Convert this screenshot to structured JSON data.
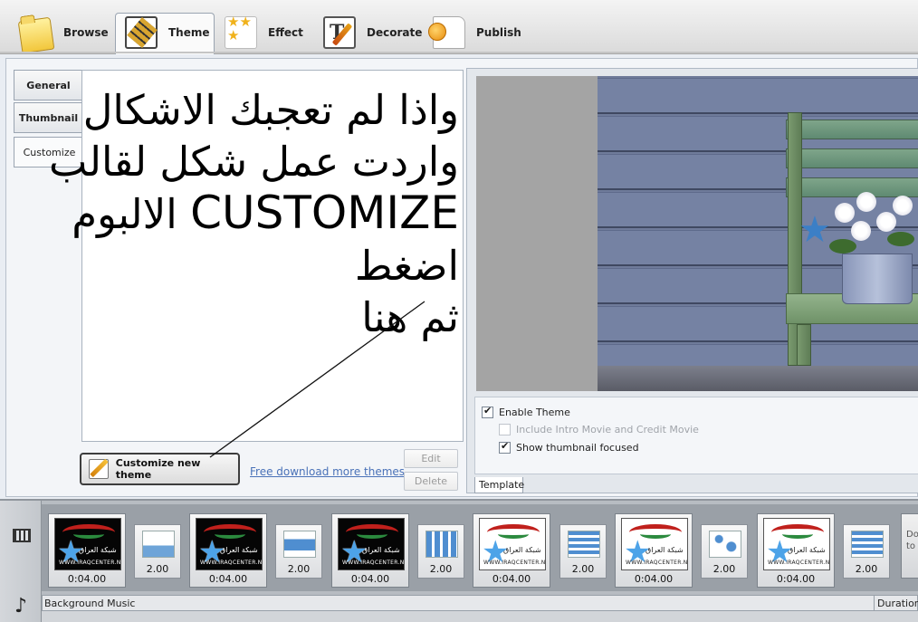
{
  "toolbar": {
    "tabs": [
      {
        "label": "Browse",
        "icon": "folder-icon"
      },
      {
        "label": "Theme",
        "icon": "film-theme-icon",
        "active": true
      },
      {
        "label": "Effect",
        "icon": "stars-icon"
      },
      {
        "label": "Decorate",
        "icon": "decorate-icon"
      },
      {
        "label": "Publish",
        "icon": "publish-icon"
      }
    ]
  },
  "sidebar": {
    "tabs": [
      {
        "label": "General"
      },
      {
        "label": "Thumbnail"
      },
      {
        "label": "Customize",
        "active": true
      }
    ]
  },
  "annotation": {
    "line1": "واذا لم تعجبك الاشكال",
    "line2": "واردت عمل شكل لقالب",
    "line3_ar": "الالبوم اضغط",
    "line3_en": "CUSTOMIZE",
    "line4": "ثم هنا"
  },
  "actions": {
    "customize_label": "Customize new theme",
    "download_link": "Free download more themes",
    "edit_label": "Edit",
    "delete_label": "Delete"
  },
  "options": {
    "enable_theme": {
      "label": "Enable Theme",
      "checked": true
    },
    "include_intro": {
      "label": "Include Intro Movie and Credit Movie",
      "checked": false,
      "disabled": true
    },
    "show_thumb": {
      "label": "Show thumbnail focused",
      "checked": true
    }
  },
  "template_tab": "Template",
  "storyboard": {
    "clips": [
      {
        "duration": "0:04.00",
        "style": "dark"
      },
      {
        "duration": "0:04.00",
        "style": "dark"
      },
      {
        "duration": "0:04.00",
        "style": "dark"
      },
      {
        "duration": "0:04.00",
        "style": "light"
      },
      {
        "duration": "0:04.00",
        "style": "light"
      },
      {
        "duration": "0:04.00",
        "style": "light"
      }
    ],
    "transitions": [
      {
        "duration": "2.00"
      },
      {
        "duration": "2.00"
      },
      {
        "duration": "2.00"
      },
      {
        "duration": "2.00"
      },
      {
        "duration": "2.00"
      },
      {
        "duration": "2.00"
      }
    ],
    "thumb_text": "شبكة العراق",
    "thumb_url": "WWW.IRAQCENTER.NET",
    "partial_clip_text": "Do\nto",
    "background_music_label": "Background Music",
    "duration_label": "Duration"
  },
  "colors": {
    "accent_link": "#4a72b8",
    "storyboard_bg": "#9aa0a7",
    "preview_wall": "#6f7b9a"
  }
}
